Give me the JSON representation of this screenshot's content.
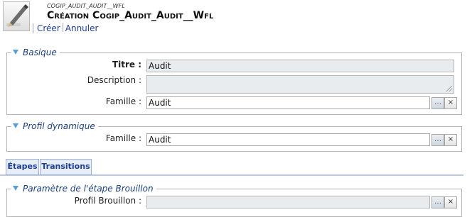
{
  "header": {
    "subtitle": "COGIP_AUDIT_AUDIT__WFL",
    "title": "Création Cogip_Audit_Audit__Wfl",
    "actions": {
      "create": "Créer",
      "cancel": "Annuler"
    }
  },
  "basique": {
    "legend": "Basique",
    "titre": {
      "label": "Titre :",
      "value": "Audit"
    },
    "description": {
      "label": "Description :",
      "value": ""
    },
    "famille": {
      "label": "Famille :",
      "value": "Audit"
    }
  },
  "profil": {
    "legend": "Profil dynamique",
    "famille": {
      "label": "Famille :",
      "value": "Audit"
    }
  },
  "tabs": [
    {
      "label": "Étapes"
    },
    {
      "label": "Transitions"
    }
  ],
  "etape": {
    "legend": "Paramètre de l'étape Brouillon",
    "profil_label": "Profil Brouillon :"
  },
  "buttons": {
    "dots": "…",
    "clear": "×"
  }
}
